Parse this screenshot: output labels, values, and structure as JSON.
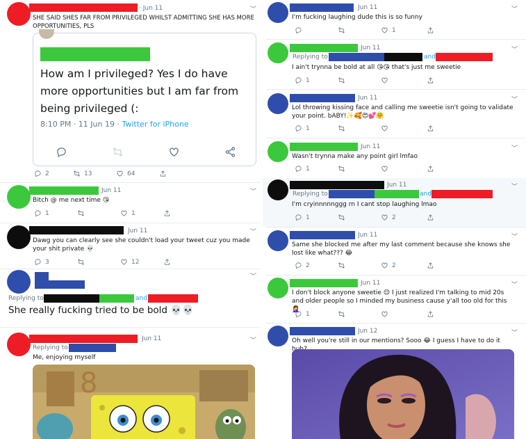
{
  "colors": {
    "red": "#ee1c24",
    "green": "#3cc83c",
    "blue": "#2f4dab",
    "black": "#0d0d0d",
    "link": "#1da1f2",
    "muted": "#657786"
  },
  "left": [
    {
      "id": "t1",
      "date": "· Jun 11",
      "text": "SHE SAID SHES FAR FROM PRIVILEGED WHILST ADMITTING SHE HAS MORE OPPORTUNITIES, PLS",
      "quote": {
        "text": "How am I privileged? Yes I do have more opportunities but I am far from being privileged (:",
        "time": "8:10 PM · 11 Jun 19 · ",
        "via": "Twitter for iPhone"
      },
      "counts": {
        "reply": "2",
        "retweet": "13",
        "like": "64"
      }
    },
    {
      "id": "t2",
      "date": "Jun 11",
      "text": "Bitch @ me next time 😘",
      "counts": {
        "reply": "1",
        "retweet": "",
        "like": "1"
      }
    },
    {
      "id": "t3",
      "date": "Jun 11",
      "text": "Dawg you can clearly see she couldn't load your tweet cuz you made your shit private 💀",
      "counts": {
        "reply": "3",
        "retweet": "",
        "like": "12"
      }
    },
    {
      "id": "t4",
      "replying": "Replying to",
      "and": "and",
      "text": "She really fucking tried to be bold 💀💀"
    },
    {
      "id": "t5",
      "date": "Jun 11",
      "replying": "Replying to",
      "text": "Me, enjoying myself"
    }
  ],
  "right": [
    {
      "id": "r1",
      "date": "Jun 11",
      "text": "I'm fucking laughing dude this is so funny",
      "counts": {
        "reply": "",
        "retweet": "",
        "like": "1"
      }
    },
    {
      "id": "r2",
      "date": "Jun 11",
      "replying": "Replying to",
      "and": "and",
      "text": "I ain't trynna be bold at all 😘😘 that's just me sweetie",
      "counts": {
        "reply": "1",
        "retweet": "",
        "like": ""
      }
    },
    {
      "id": "r3",
      "date": "Jun 11",
      "text": "Lol throwing kissing face and calling me sweetie isn't going to validate your point. bABY!✨🥰😍💕🤗",
      "counts": {
        "reply": "1",
        "retweet": "",
        "like": ""
      }
    },
    {
      "id": "r4",
      "date": "Jun 11",
      "text": "Wasn't trynna make any point girl lmfao",
      "counts": {
        "reply": "1",
        "retweet": "",
        "like": ""
      }
    },
    {
      "id": "r5",
      "date": "Jun 11",
      "replying": "Replying to",
      "and": "and",
      "text": "I'm cryinnnnnggg rn I cant stop laughing lmao",
      "counts": {
        "reply": "1",
        "retweet": "",
        "like": "2"
      }
    },
    {
      "id": "r6",
      "date": "Jun 11",
      "text": "Same she blocked me after my last comment because she knows she lost like what??? 😂",
      "counts": {
        "reply": "2",
        "retweet": "",
        "like": "2"
      }
    },
    {
      "id": "r7",
      "date": "Jun 11",
      "text": "I don't block anyone sweetie 😌 I just realized I'm talking to mid 20s and older people so I minded my business cause y'all too old for this 🤦‍♀️",
      "counts": {
        "reply": "1",
        "retweet": "",
        "like": ""
      }
    },
    {
      "id": "r8",
      "date": "Jun 12",
      "text": "Oh well you're still in our mentions? Sooo 😂 I guess I have to do it huh?"
    }
  ]
}
